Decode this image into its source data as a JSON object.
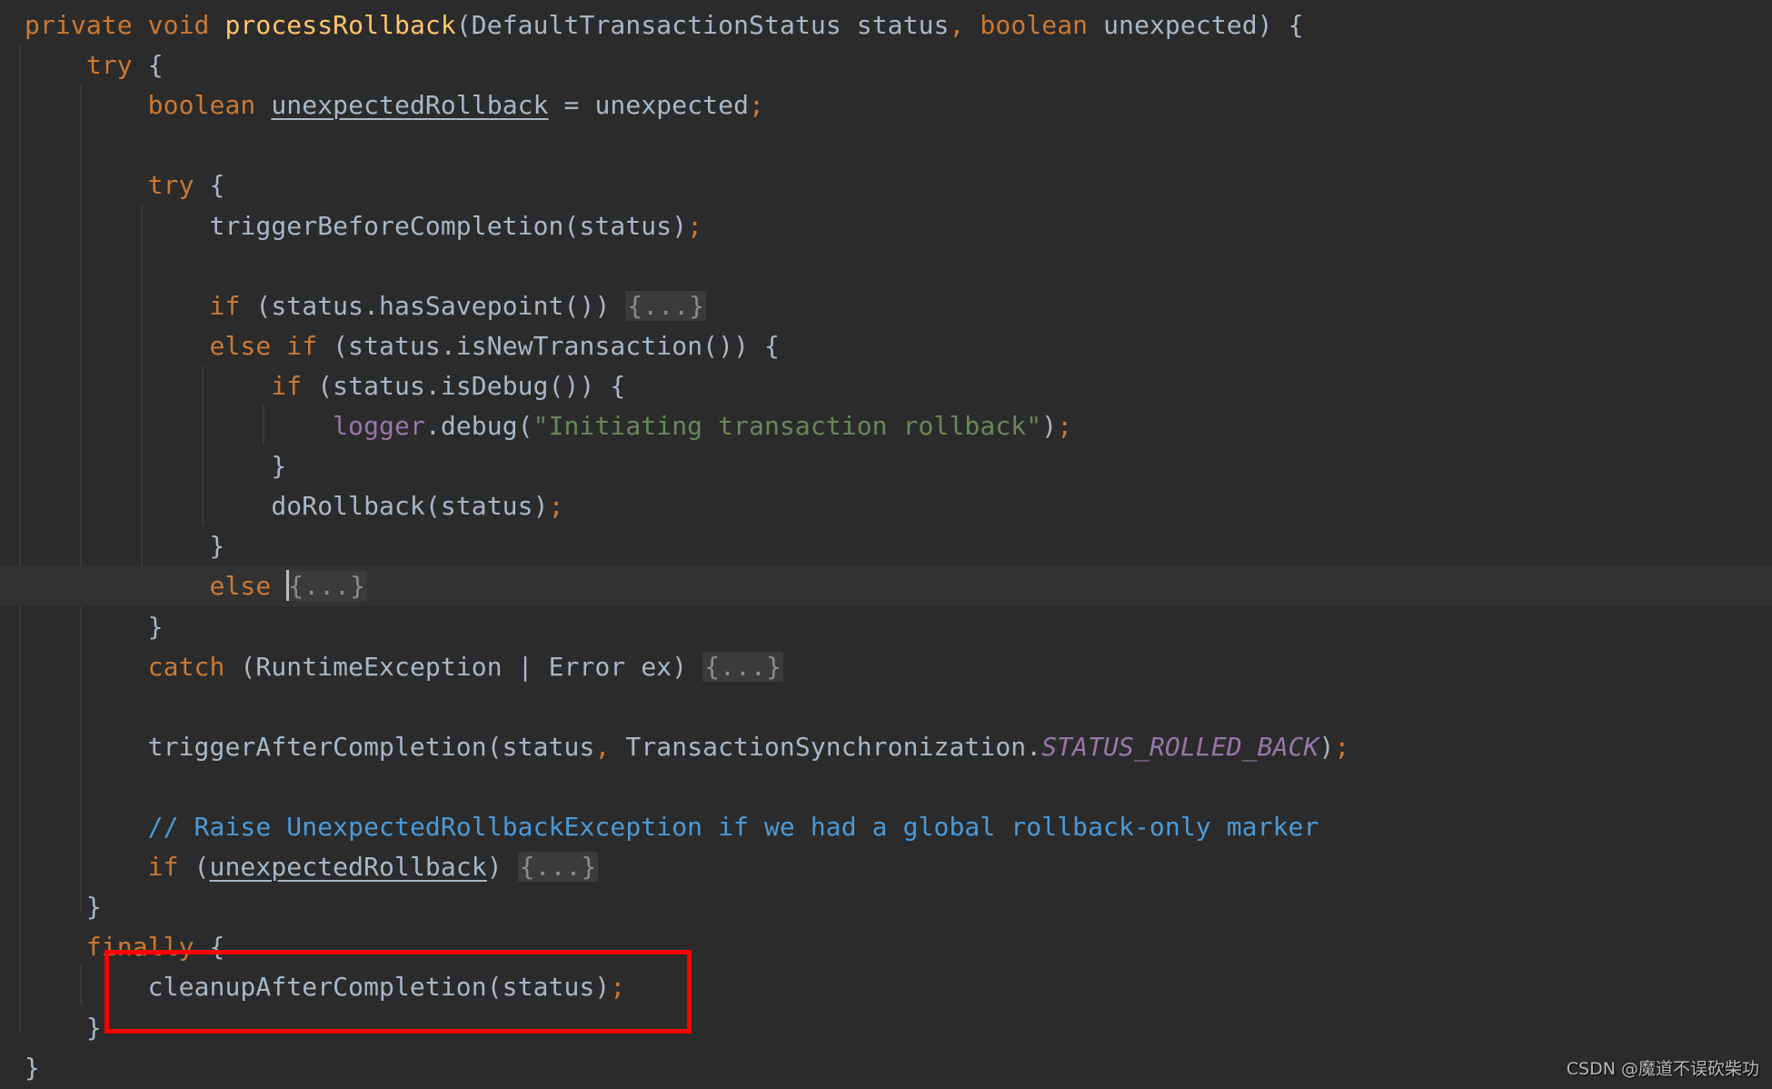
{
  "editor": {
    "language": "java",
    "method_name": "processRollback",
    "lines": [
      {
        "tokens": [
          [
            "kw",
            "private "
          ],
          [
            "kw",
            "void "
          ],
          [
            "fn",
            "processRollback"
          ],
          [
            "t",
            "(DefaultTransactionStatus status"
          ],
          [
            "punc",
            ", "
          ],
          [
            "kw",
            "boolean "
          ],
          [
            "t",
            "unexpected) {"
          ]
        ]
      },
      {
        "tokens": [
          [
            "t",
            "    "
          ],
          [
            "kw",
            "try "
          ],
          [
            "t",
            "{"
          ]
        ]
      },
      {
        "tokens": [
          [
            "t",
            "        "
          ],
          [
            "kw",
            "boolean "
          ],
          [
            "ul",
            "unexpectedRollback"
          ],
          [
            "t",
            " = unexpected"
          ],
          [
            "punc",
            ";"
          ]
        ]
      },
      {
        "tokens": []
      },
      {
        "tokens": [
          [
            "t",
            "        "
          ],
          [
            "kw",
            "try "
          ],
          [
            "t",
            "{"
          ]
        ]
      },
      {
        "tokens": [
          [
            "t",
            "            triggerBeforeCompletion(status)"
          ],
          [
            "punc",
            ";"
          ]
        ]
      },
      {
        "tokens": []
      },
      {
        "tokens": [
          [
            "t",
            "            "
          ],
          [
            "kw",
            "if "
          ],
          [
            "t",
            "(status.hasSavepoint()) "
          ],
          [
            "fold",
            "{...}"
          ]
        ]
      },
      {
        "tokens": [
          [
            "t",
            "            "
          ],
          [
            "kw",
            "else if "
          ],
          [
            "t",
            "(status.isNewTransaction()) {"
          ]
        ]
      },
      {
        "tokens": [
          [
            "t",
            "                "
          ],
          [
            "kw",
            "if "
          ],
          [
            "t",
            "(status.isDebug()) {"
          ]
        ]
      },
      {
        "tokens": [
          [
            "t",
            "                    "
          ],
          [
            "field",
            "logger"
          ],
          [
            "t",
            ".debug("
          ],
          [
            "str",
            "\"Initiating transaction rollback\""
          ],
          [
            "t",
            ")"
          ],
          [
            "punc",
            ";"
          ]
        ]
      },
      {
        "tokens": [
          [
            "t",
            "                }"
          ]
        ]
      },
      {
        "tokens": [
          [
            "t",
            "                doRollback(status)"
          ],
          [
            "punc",
            ";"
          ]
        ]
      },
      {
        "tokens": [
          [
            "t",
            "            }"
          ]
        ]
      },
      {
        "tokens": [
          [
            "t",
            "            "
          ],
          [
            "kw",
            "else "
          ],
          [
            "caret",
            ""
          ],
          [
            "fold",
            "{...}"
          ]
        ],
        "current": true
      },
      {
        "tokens": [
          [
            "t",
            "        }"
          ]
        ]
      },
      {
        "tokens": [
          [
            "t",
            "        "
          ],
          [
            "kw",
            "catch "
          ],
          [
            "t",
            "(RuntimeException | Error ex) "
          ],
          [
            "fold",
            "{...}"
          ]
        ]
      },
      {
        "tokens": []
      },
      {
        "tokens": [
          [
            "t",
            "        triggerAfterCompletion(status"
          ],
          [
            "punc",
            ", "
          ],
          [
            "t",
            "TransactionSynchronization."
          ],
          [
            "const",
            "STATUS_ROLLED_BACK"
          ],
          [
            "t",
            ")"
          ],
          [
            "punc",
            ";"
          ]
        ]
      },
      {
        "tokens": []
      },
      {
        "tokens": [
          [
            "t",
            "        "
          ],
          [
            "cmt",
            "// Raise UnexpectedRollbackException if we had a global rollback-only marker"
          ]
        ]
      },
      {
        "tokens": [
          [
            "t",
            "        "
          ],
          [
            "kw",
            "if "
          ],
          [
            "t",
            "("
          ],
          [
            "ul",
            "unexpectedRollback"
          ],
          [
            "t",
            ") "
          ],
          [
            "fold",
            "{...}"
          ]
        ]
      },
      {
        "tokens": [
          [
            "t",
            "    }"
          ]
        ]
      },
      {
        "tokens": [
          [
            "t",
            "    "
          ],
          [
            "kw",
            "finally "
          ],
          [
            "t",
            "{"
          ]
        ]
      },
      {
        "tokens": [
          [
            "t",
            "        cleanupAfterCompletion(status)"
          ],
          [
            "punc",
            ";"
          ]
        ]
      },
      {
        "tokens": [
          [
            "t",
            "    }"
          ]
        ]
      },
      {
        "tokens": [
          [
            "t",
            "}"
          ]
        ]
      }
    ]
  },
  "annotation": {
    "type": "red-rectangle",
    "target_text": "cleanupAfterCompletion(status);",
    "color": "#ff0000"
  },
  "watermark": {
    "text": "CSDN @魔道不误砍柴功"
  },
  "colors": {
    "background": "#2b2b2b",
    "keyword": "#cc7832",
    "method_declaration": "#ffc66d",
    "default_text": "#a9b7c6",
    "string": "#6a8759",
    "field": "#9876aa",
    "comment": "#4a9ad8",
    "current_line": "#323232"
  }
}
